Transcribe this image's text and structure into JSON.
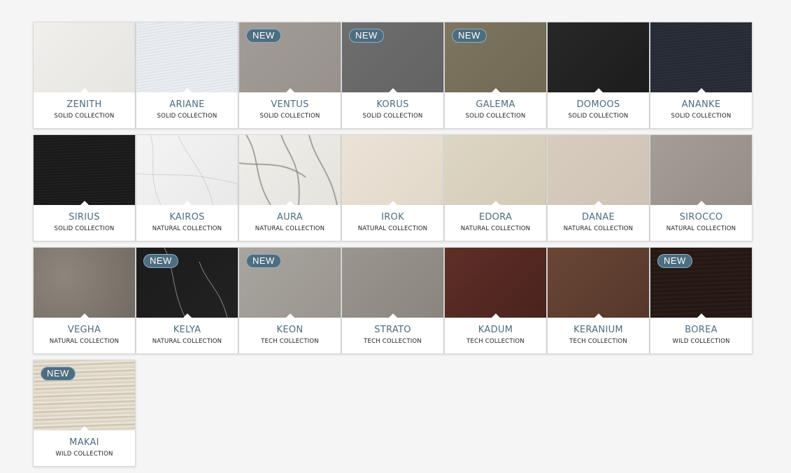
{
  "badge_label": "NEW",
  "products": [
    {
      "name": "ZENITH",
      "collection": "SOLID COLLECTION",
      "is_new": false,
      "swatch": "linear-gradient(135deg,#f0efec,#e6e5e2)"
    },
    {
      "name": "ARIANE",
      "collection": "SOLID COLLECTION",
      "is_new": false,
      "swatch": "repeating-linear-gradient(172deg,#e9edf1 0px,#dde3e9 2px,#f1f3f6 4px),linear-gradient(90deg,#cfd8e0,#eef1f4)"
    },
    {
      "name": "VENTUS",
      "collection": "SOLID COLLECTION",
      "is_new": true,
      "swatch": "linear-gradient(135deg,#a29c97,#98918c)"
    },
    {
      "name": "KORUS",
      "collection": "SOLID COLLECTION",
      "is_new": true,
      "swatch": "linear-gradient(135deg,#6e6e6e,#636363)"
    },
    {
      "name": "GALEMA",
      "collection": "SOLID COLLECTION",
      "is_new": true,
      "swatch": "linear-gradient(135deg,#7e7560,#716953)"
    },
    {
      "name": "DOMOOS",
      "collection": "SOLID COLLECTION",
      "is_new": false,
      "swatch": "linear-gradient(135deg,#282828,#1c1c1c)"
    },
    {
      "name": "ANANKE",
      "collection": "SOLID COLLECTION",
      "is_new": false,
      "swatch": "repeating-linear-gradient(175deg,#2a2e38 0px,#242832 2px,#30343e 4px)"
    },
    {
      "name": "SIRIUS",
      "collection": "SOLID COLLECTION",
      "is_new": false,
      "swatch": "repeating-linear-gradient(178deg,#1e1e1e 0px,#171717 2px,#232323 4px)"
    },
    {
      "name": "KAIROS",
      "collection": "NATURAL COLLECTION",
      "is_new": false,
      "swatch": "linear-gradient(135deg,#f4f4f4,#e9e9ea)",
      "veins": "light"
    },
    {
      "name": "AURA",
      "collection": "NATURAL COLLECTION",
      "is_new": false,
      "swatch": "linear-gradient(135deg,#efeeea,#e5e3de)",
      "veins": "heavy"
    },
    {
      "name": "IROK",
      "collection": "NATURAL COLLECTION",
      "is_new": false,
      "swatch": "linear-gradient(135deg,#ebe3d6,#e1d8c9)"
    },
    {
      "name": "EDORA",
      "collection": "NATURAL COLLECTION",
      "is_new": false,
      "swatch": "linear-gradient(135deg,#ddd6c3,#d3cbb6)"
    },
    {
      "name": "DANAE",
      "collection": "NATURAL COLLECTION",
      "is_new": false,
      "swatch": "linear-gradient(135deg,#d8ccbf,#cfc3b5)"
    },
    {
      "name": "SIROCCO",
      "collection": "NATURAL COLLECTION",
      "is_new": false,
      "swatch": "linear-gradient(135deg,#a59e96,#958e86)"
    },
    {
      "name": "VEGHA",
      "collection": "NATURAL COLLECTION",
      "is_new": false,
      "swatch": "radial-gradient(circle at 30% 40%,#8d867d,#726b63)"
    },
    {
      "name": "KELYA",
      "collection": "NATURAL COLLECTION",
      "is_new": true,
      "swatch": "linear-gradient(135deg,#1b1b1b,#222222)",
      "veins": "dark"
    },
    {
      "name": "KEON",
      "collection": "TECH COLLECTION",
      "is_new": true,
      "swatch": "linear-gradient(135deg,#a8a49e,#9a968f)"
    },
    {
      "name": "STRATO",
      "collection": "TECH COLLECTION",
      "is_new": false,
      "swatch": "linear-gradient(135deg,#9b958f,#8b857f)"
    },
    {
      "name": "KADUM",
      "collection": "TECH COLLECTION",
      "is_new": false,
      "swatch": "linear-gradient(135deg,#5e2f27,#4a231d)"
    },
    {
      "name": "KERANIUM",
      "collection": "TECH COLLECTION",
      "is_new": false,
      "swatch": "linear-gradient(135deg,#6a4636,#55382b)"
    },
    {
      "name": "BOREA",
      "collection": "WILD COLLECTION",
      "is_new": true,
      "swatch": "repeating-linear-gradient(178deg,#2a1c18 0px,#221612 3px,#302019 6px)"
    },
    {
      "name": "MAKAI",
      "collection": "WILD COLLECTION",
      "is_new": true,
      "swatch": "repeating-linear-gradient(178deg,#e9e3d6 0px,#d8cfbd 3px,#efeae0 6px,#c9bea8 8px,#ece6da 11px)"
    }
  ]
}
